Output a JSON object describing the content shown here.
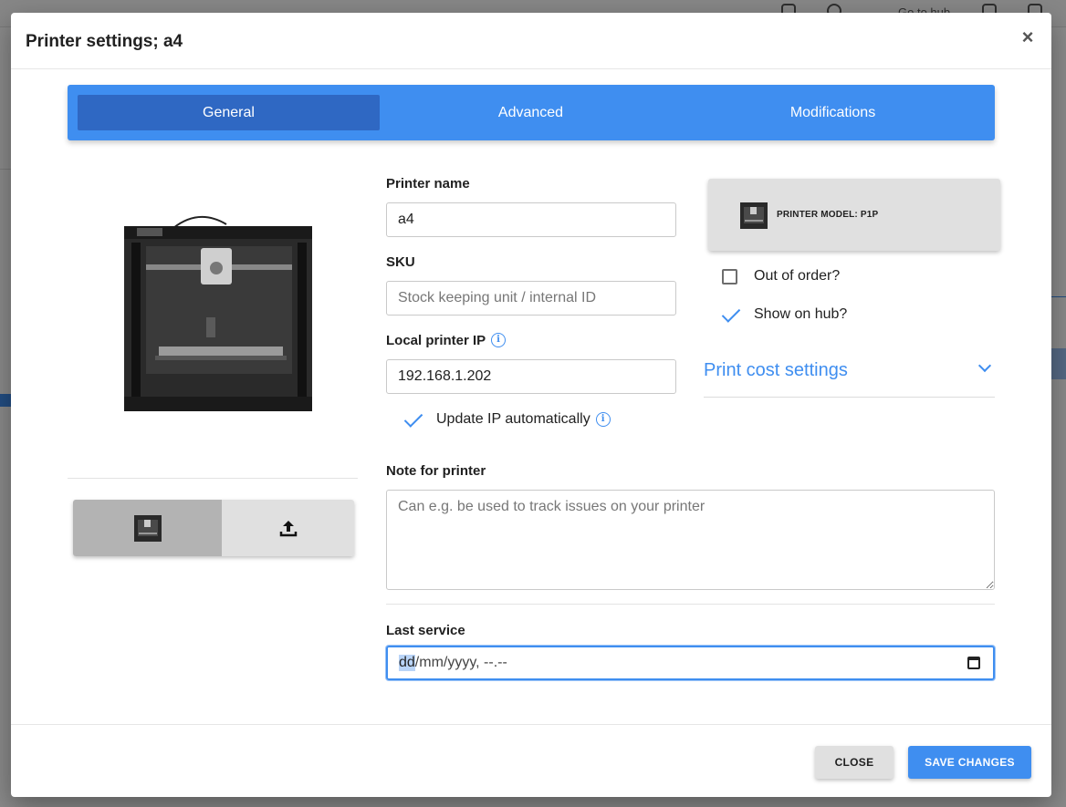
{
  "background": {
    "topbar_link": "Go to hub"
  },
  "dialog": {
    "title": "Printer settings; a4",
    "close_icon": "close-icon"
  },
  "tabs": [
    {
      "label": "General",
      "active": true
    },
    {
      "label": "Advanced",
      "active": false
    },
    {
      "label": "Modifications",
      "active": false
    }
  ],
  "form": {
    "printer_name": {
      "label": "Printer name",
      "value": "a4"
    },
    "sku": {
      "label": "SKU",
      "value": "",
      "placeholder": "Stock keeping unit / internal ID"
    },
    "local_ip": {
      "label": "Local printer IP",
      "value": "192.168.1.202"
    },
    "update_ip": {
      "label": "Update IP automatically",
      "checked": true
    },
    "note": {
      "label": "Note for printer",
      "value": "",
      "placeholder": "Can e.g. be used to track issues on your printer"
    },
    "last_service": {
      "label": "Last service",
      "placeholder_day": "dd",
      "placeholder_rest": "/mm/yyyy, --.--"
    }
  },
  "printer_model": {
    "label": "PRINTER MODEL: P1P"
  },
  "out_of_order": {
    "label": "Out of order?",
    "checked": false
  },
  "show_on_hub": {
    "label": "Show on hub?",
    "checked": true
  },
  "print_cost": {
    "label": "Print cost settings",
    "expanded": false
  },
  "footer": {
    "close_label": "CLOSE",
    "save_label": "SAVE CHANGES"
  },
  "colors": {
    "accent": "#3f8ef0",
    "tab_active": "#2f68c3"
  }
}
